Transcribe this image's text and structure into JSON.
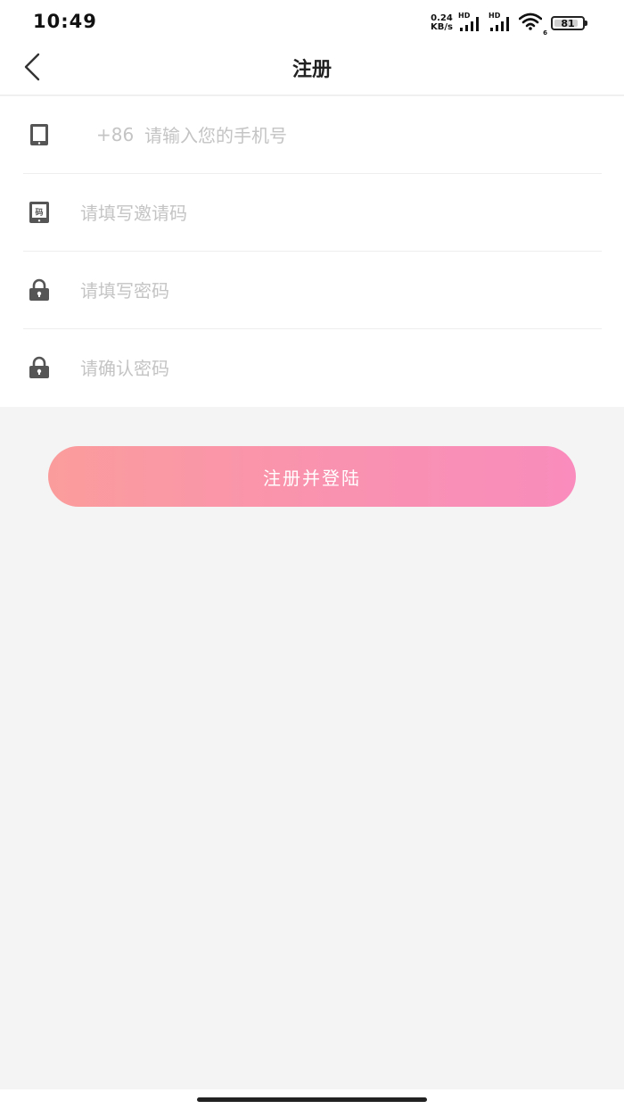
{
  "status_bar": {
    "time": "10:49",
    "net_speed_value": "0.24",
    "net_speed_unit": "KB/s",
    "signal1_label": "HD",
    "signal2_label": "HD",
    "wifi_label": "6",
    "battery": "81"
  },
  "header": {
    "title": "注册"
  },
  "form": {
    "phone_prefix": "+86",
    "phone_placeholder": "请输入您的手机号",
    "invite_placeholder": "请填写邀请码",
    "invite_icon_text": "码",
    "password_placeholder": "请填写密码",
    "confirm_placeholder": "请确认密码"
  },
  "submit_label": "注册并登陆",
  "colors": {
    "accent_start": "#fb9c9c",
    "accent_end": "#f98cbc",
    "background": "#f4f4f4",
    "icon": "#555555",
    "placeholder": "#c4c4c4"
  },
  "icons": [
    "back-arrow-icon",
    "tablet-icon",
    "invite-code-icon",
    "lock-icon"
  ]
}
